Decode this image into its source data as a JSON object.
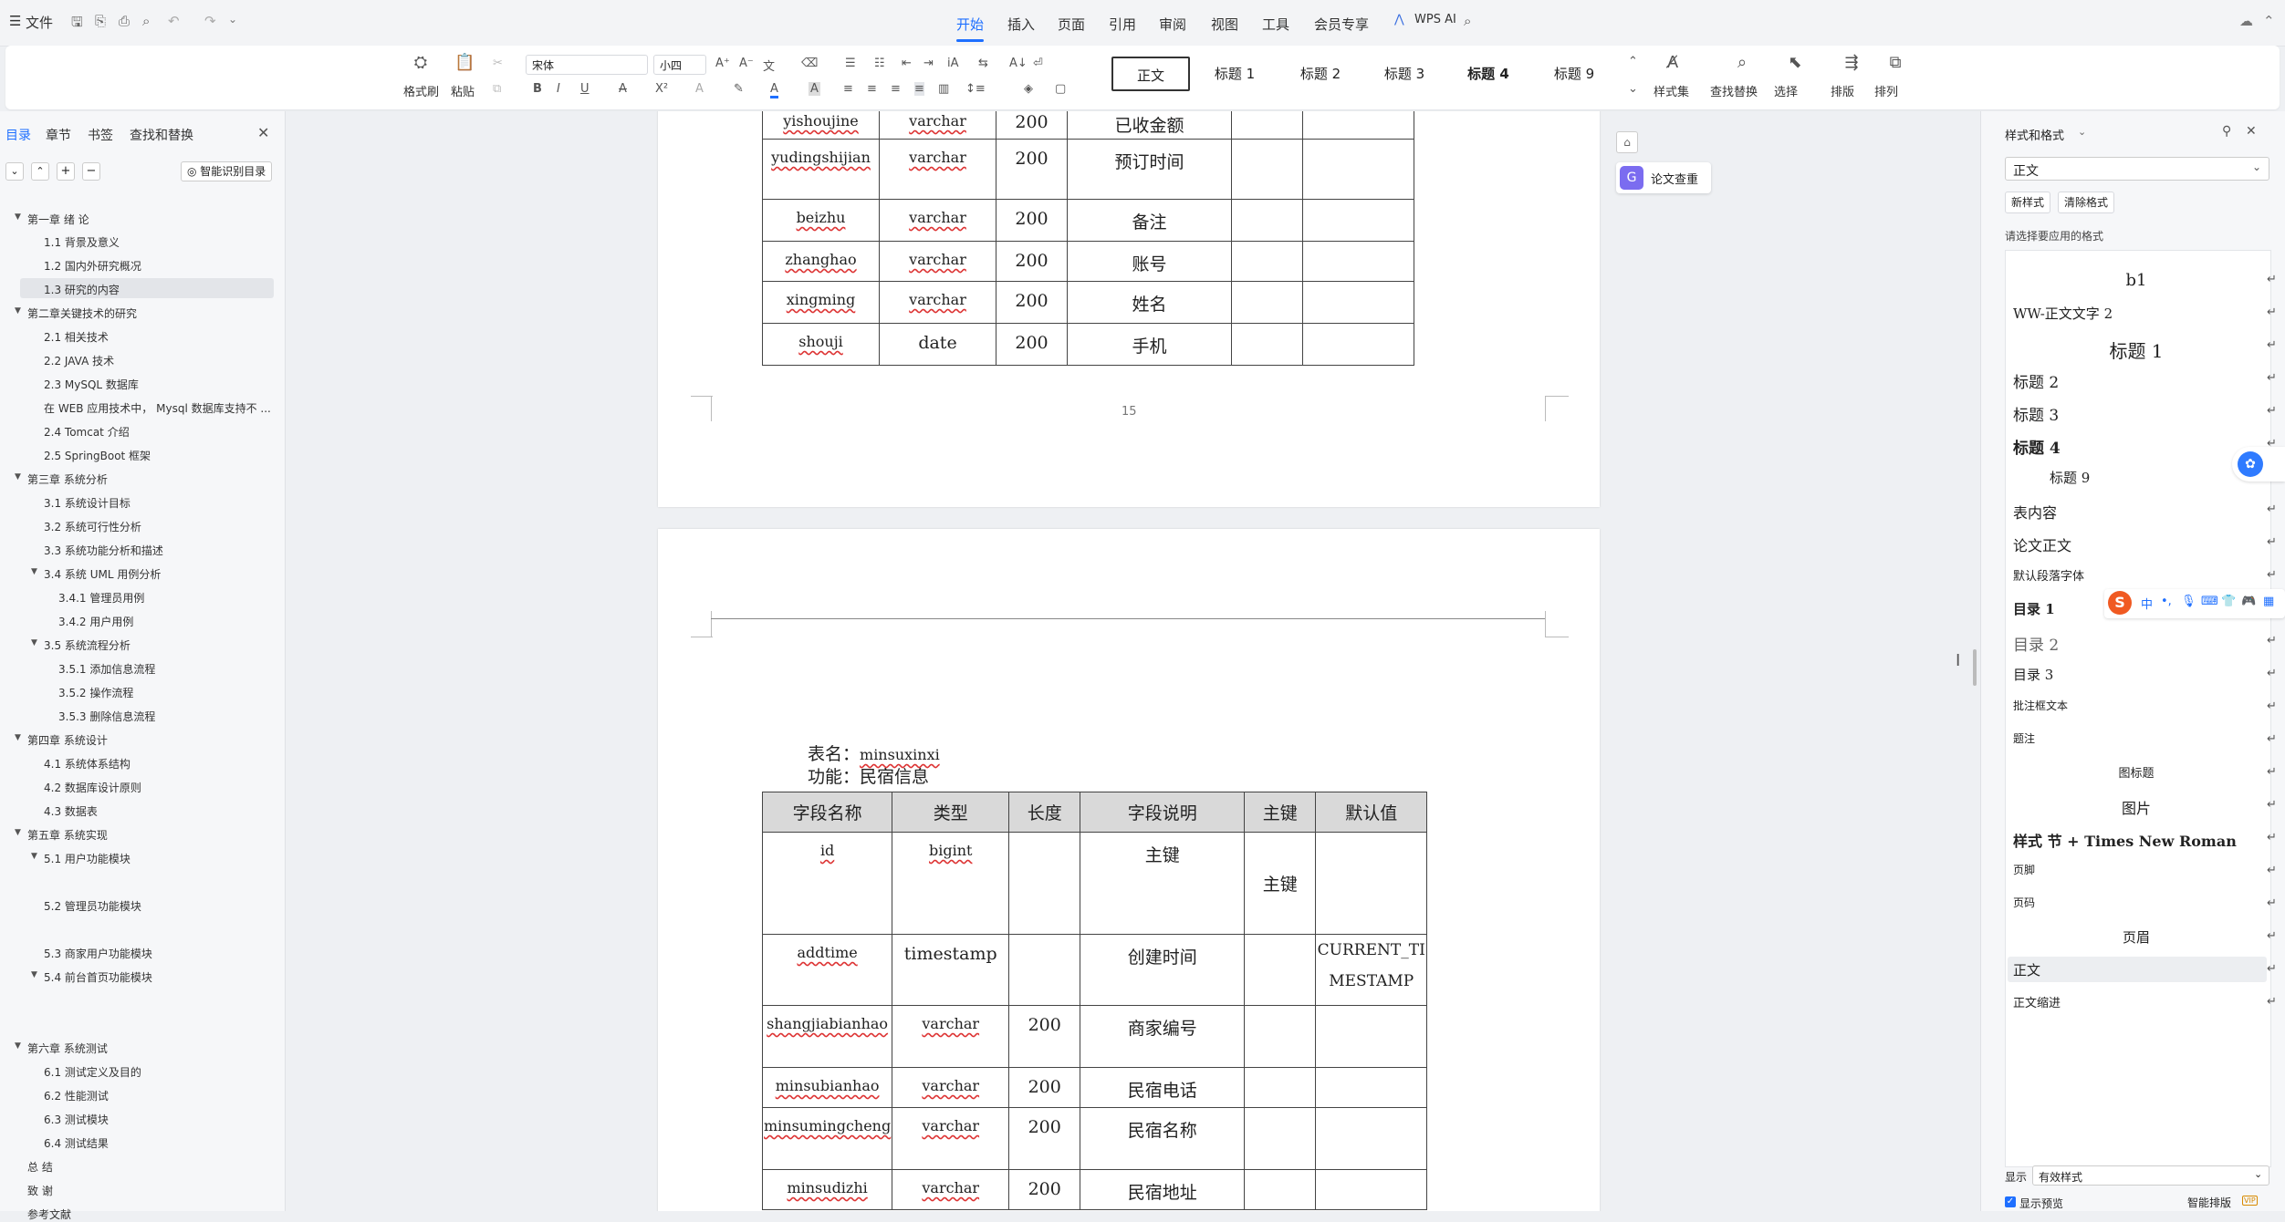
{
  "topbar": {
    "file_menu": "文件",
    "tabs": [
      "开始",
      "插入",
      "页面",
      "引用",
      "审阅",
      "视图",
      "工具",
      "会员专享"
    ],
    "wps_ai": "WPS AI"
  },
  "ribbon": {
    "format_painter": "格式刷",
    "paste": "粘贴",
    "font_name": "宋体",
    "font_size": "小四",
    "styles": [
      "正文",
      "标题 1",
      "标题 2",
      "标题 3",
      "标题 4",
      "标题 9"
    ],
    "style_set": "样式集",
    "find_replace": "查找替换",
    "select": "选择",
    "layout": "排版",
    "arrange": "排列"
  },
  "leftpanel": {
    "tabs": [
      "目录",
      "章节",
      "书签",
      "查找和替换"
    ],
    "smart_toc": "智能识别目录",
    "toc": [
      {
        "text": "第一章  绪 论",
        "level": 0,
        "arrow": true
      },
      {
        "text": "1.1 背景及意义",
        "level": 1
      },
      {
        "text": "1.2 国内外研究概况",
        "level": 1
      },
      {
        "text": "1.3  研究的内容",
        "level": 1,
        "selected": true
      },
      {
        "text": "第二章关键技术的研究",
        "level": 0,
        "arrow": true
      },
      {
        "text": "2.1 相关技术",
        "level": 1
      },
      {
        "text": "2.2 JAVA 技术",
        "level": 1
      },
      {
        "text": "2.3 MySQL 数据库",
        "level": 1
      },
      {
        "text": "在 WEB 应用技术中，  Mysql 数据库支持不 ...",
        "level": 1
      },
      {
        "text": "2.4 Tomcat 介绍",
        "level": 1
      },
      {
        "text": "2.5 SpringBoot 框架",
        "level": 1
      },
      {
        "text": "第三章  系统分析",
        "level": 0,
        "arrow": true
      },
      {
        "text": "3.1  系统设计目标",
        "level": 1
      },
      {
        "text": "3.2  系统可行性分析",
        "level": 1
      },
      {
        "text": "3.3  系统功能分析和描述",
        "level": 1
      },
      {
        "text": "3.4 系统 UML 用例分析",
        "level": 1,
        "arrow": true
      },
      {
        "text": "3.4.1 管理员用例",
        "level": 2
      },
      {
        "text": "3.4.2 用户用例",
        "level": 2
      },
      {
        "text": "3.5 系统流程分析",
        "level": 1,
        "arrow": true
      },
      {
        "text": "3.5.1 添加信息流程",
        "level": 2
      },
      {
        "text": "3.5.2 操作流程",
        "level": 2
      },
      {
        "text": "3.5.3 删除信息流程",
        "level": 2
      },
      {
        "text": "第四章  系统设计",
        "level": 0,
        "arrow": true
      },
      {
        "text": "4.1  系统体系结构",
        "level": 1
      },
      {
        "text": "4.2  数据库设计原则",
        "level": 1
      },
      {
        "text": "4.3  数据表",
        "level": 1
      },
      {
        "text": "第五章  系统实现",
        "level": 0,
        "arrow": true
      },
      {
        "text": "5.1 用户功能模块",
        "level": 1,
        "arrow": true
      },
      {
        "text": "5.2 管理员功能模块",
        "level": 1
      },
      {
        "text": "5.3 商家用户功能模块",
        "level": 1
      },
      {
        "text": "5.4 前台首页功能模块",
        "level": 1,
        "arrow": true
      },
      {
        "text": "第六章  系统测试",
        "level": 0,
        "arrow": true
      },
      {
        "text": "6.1 测试定义及目的",
        "level": 1
      },
      {
        "text": "6.2 性能测试",
        "level": 1
      },
      {
        "text": "6.3 测试模块",
        "level": 1
      },
      {
        "text": "6.4 测试结果",
        "level": 1
      },
      {
        "text": "总  结",
        "level": 0
      },
      {
        "text": "致  谢",
        "level": 0
      },
      {
        "text": "参考文献",
        "level": 0
      }
    ]
  },
  "doc": {
    "table1_rows": [
      [
        "yishoujine",
        "varchar",
        "200",
        "已收金额",
        "",
        ""
      ],
      [
        "yudingshijian",
        "varchar",
        "200",
        "预订时间",
        "",
        ""
      ],
      [
        "beizhu",
        "varchar",
        "200",
        "备注",
        "",
        ""
      ],
      [
        "zhanghao",
        "varchar",
        "200",
        "账号",
        "",
        ""
      ],
      [
        "xingming",
        "varchar",
        "200",
        "姓名",
        "",
        ""
      ],
      [
        "shouji",
        "date",
        "200",
        "手机",
        "",
        ""
      ]
    ],
    "page_number": "15",
    "table_name_label": "表名：",
    "table_name": "minsuxinxi",
    "function_label": "功能：",
    "function_text": "民宿信息",
    "headers": [
      "字段名称",
      "类型",
      "长度",
      "字段说明",
      "主键",
      "默认值"
    ],
    "table2_rows": [
      [
        "id",
        "bigint",
        "",
        "主键",
        "主键",
        ""
      ],
      [
        "addtime",
        "timestamp",
        "",
        "创建时间",
        "",
        "CURRENT_TIMESTAMP"
      ],
      [
        "shangjiabianhao",
        "varchar",
        "200",
        "商家编号",
        "",
        ""
      ],
      [
        "minsubianhao",
        "varchar",
        "200",
        "民宿电话",
        "",
        ""
      ],
      [
        "minsumingcheng",
        "varchar",
        "200",
        "民宿名称",
        "",
        ""
      ],
      [
        "minsudizhi",
        "varchar",
        "200",
        "民宿地址",
        "",
        ""
      ]
    ],
    "paper_check": "论文查重"
  },
  "rightpanel": {
    "title": "样式和格式",
    "current_style": "正文",
    "new_style": "新样式",
    "clear_format": "清除格式",
    "prompt": "请选择要应用的格式",
    "styles": [
      {
        "text": "b1",
        "size": 18,
        "center": true,
        "bold": false
      },
      {
        "text": "WW-正文文字 2",
        "size": 15
      },
      {
        "text": "标题 1",
        "size": 20,
        "center": true
      },
      {
        "text": "标题 2",
        "size": 17
      },
      {
        "text": "标题 3",
        "size": 17
      },
      {
        "text": "标题 4",
        "size": 17,
        "bold": true
      },
      {
        "text": "标题 9",
        "size": 15,
        "indent": true
      },
      {
        "text": "表内容",
        "size": 16
      },
      {
        "text": "论文正文",
        "size": 16
      },
      {
        "text": "默认段落字体",
        "size": 13
      },
      {
        "text": "目录 1",
        "size": 15,
        "bold": true
      },
      {
        "text": "目录 2",
        "size": 17,
        "gray": true
      },
      {
        "text": "目录 3",
        "size": 15
      },
      {
        "text": "批注框文本",
        "size": 12
      },
      {
        "text": "题注",
        "size": 12
      },
      {
        "text": "图标题",
        "size": 13,
        "center": true
      },
      {
        "text": "图片",
        "size": 16,
        "center": true
      },
      {
        "text": "样式 节 + Times New Roman",
        "size": 16,
        "bold": true
      },
      {
        "text": "页脚",
        "size": 12
      },
      {
        "text": "页码",
        "size": 12
      },
      {
        "text": "页眉",
        "size": 15,
        "center": true
      },
      {
        "text": "正文",
        "size": 15,
        "selected": true
      },
      {
        "text": "正文缩进",
        "size": 13
      }
    ],
    "show_label": "显示",
    "show_value": "有效样式",
    "show_preview": "显示预览",
    "smart_layout": "智能排版"
  }
}
